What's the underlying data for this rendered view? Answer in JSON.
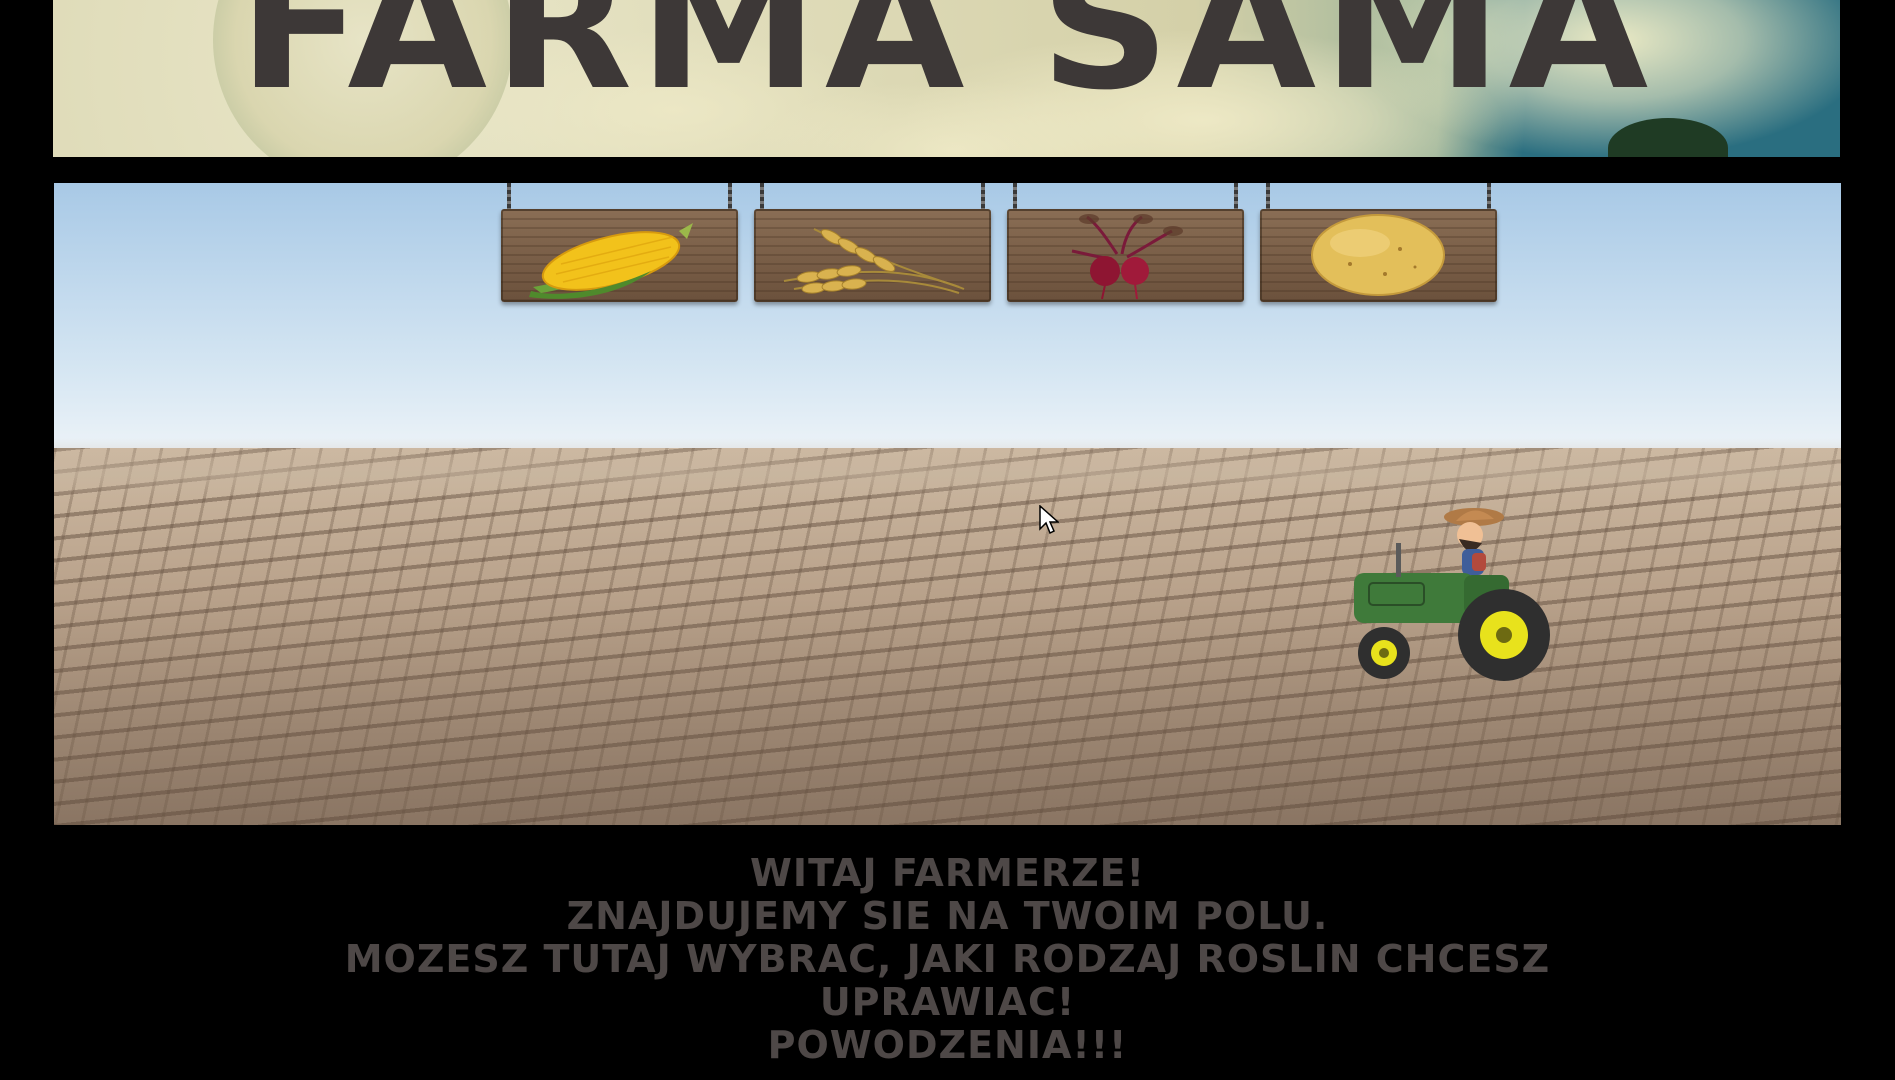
{
  "banner": {
    "title": "FARMA SAMA"
  },
  "crop_signs": [
    {
      "name": "corn",
      "icon": "corn-icon"
    },
    {
      "name": "wheat",
      "icon": "wheat-icon"
    },
    {
      "name": "beet",
      "icon": "beet-icon"
    },
    {
      "name": "potato",
      "icon": "potato-icon"
    }
  ],
  "message": {
    "line1": "WITAJ FARMERZE!",
    "line2": "ZNAJDUJEMY SIE NA TWOIM POLU.",
    "line3": "MOZESZ TUTAJ WYBRAC, JAKI RODZAJ ROSLIN CHCESZ",
    "line4": "UPRAWIAC!",
    "line5": "POWODZENIA!!!"
  },
  "colors": {
    "title": "#3d3837",
    "message": "#4e4847",
    "background": "#000000",
    "tractor_body": "#3f7a3a",
    "tractor_wheel": "#e8e21c"
  }
}
